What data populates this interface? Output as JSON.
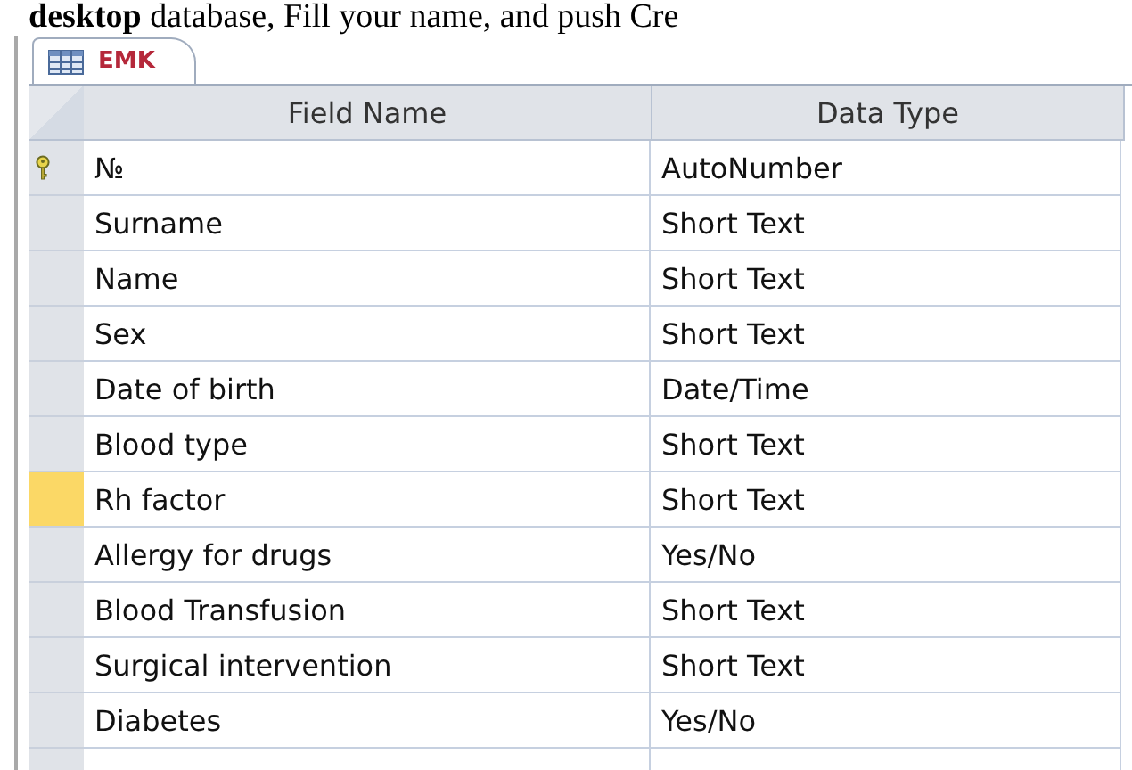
{
  "caption": "**desktop** database, Fill your name, and push Cre",
  "tab": {
    "label": "EMK",
    "selected": true
  },
  "columns": [
    "Field Name",
    "Data Type"
  ],
  "rows": [
    {
      "field": "№",
      "type": "AutoNumber",
      "primary_key": true,
      "selected": false
    },
    {
      "field": "Surname",
      "type": "Short Text",
      "primary_key": false,
      "selected": false
    },
    {
      "field": "Name",
      "type": "Short Text",
      "primary_key": false,
      "selected": false
    },
    {
      "field": "Sex",
      "type": "Short Text",
      "primary_key": false,
      "selected": false
    },
    {
      "field": "Date of birth",
      "type": "Date/Time",
      "primary_key": false,
      "selected": false
    },
    {
      "field": "Blood type",
      "type": "Short Text",
      "primary_key": false,
      "selected": false
    },
    {
      "field": "Rh factor",
      "type": "Short Text",
      "primary_key": false,
      "selected": true
    },
    {
      "field": "Allergy for drugs",
      "type": "Yes/No",
      "primary_key": false,
      "selected": false
    },
    {
      "field": "Blood Transfusion",
      "type": "Short Text",
      "primary_key": false,
      "selected": false
    },
    {
      "field": "Surgical intervention",
      "type": "Short Text",
      "primary_key": false,
      "selected": false
    },
    {
      "field": "Diabetes",
      "type": "Yes/No",
      "primary_key": false,
      "selected": false
    }
  ]
}
